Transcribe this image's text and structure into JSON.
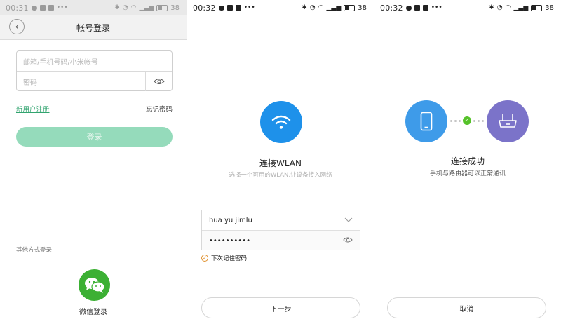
{
  "screen1": {
    "status": {
      "time": "00:31",
      "battery": "38"
    },
    "title": "帐号登录",
    "account_placeholder": "邮箱/手机号码/小米帐号",
    "password_placeholder": "密码",
    "register_link": "新用户注册",
    "forgot_link": "忘记密码",
    "login_button": "登录",
    "other_login_label": "其他方式登录",
    "wechat_label": "微信登录",
    "colors": {
      "primary_green": "#95dbbb",
      "link_green": "#32a46f",
      "wechat_green": "#3cb034"
    }
  },
  "screen2": {
    "status": {
      "time": "00:32",
      "battery": "38"
    },
    "title": "连接WLAN",
    "subtitle": "选择一个可用的WLAN,让设备接入网络",
    "ssid_value": "hua yu jimlu",
    "password_value": "••••••••••",
    "remember_label": "下次记住密码",
    "remember_checked": true,
    "next_button": "下一步",
    "icons": [
      "wifi-icon",
      "chevron-down-icon",
      "eye-icon",
      "check-icon"
    ],
    "colors": {
      "wifi_blue": "#1e91ea",
      "check_orange": "#e0902d"
    }
  },
  "screen3": {
    "status": {
      "time": "00:32",
      "battery": "38"
    },
    "title": "连接成功",
    "subtitle": "手机与路由器可以正常通讯",
    "cancel_button": "取消",
    "icons": [
      "phone-icon",
      "router-icon",
      "success-check-icon"
    ],
    "colors": {
      "phone_blue": "#3e9be9",
      "router_purple": "#7b73c9",
      "success_green": "#56c22a"
    }
  }
}
